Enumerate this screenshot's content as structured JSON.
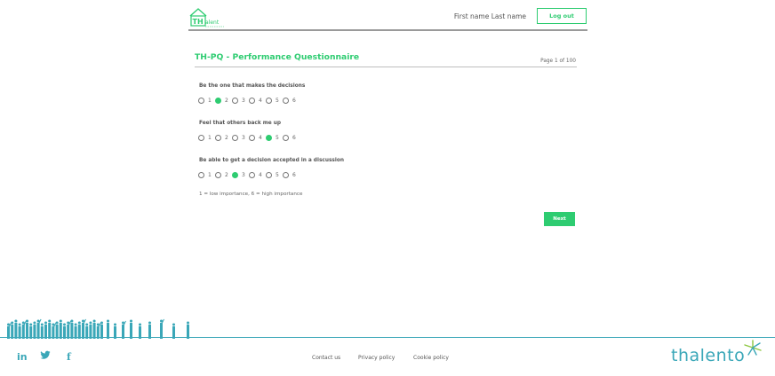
{
  "header": {
    "logo_text": "TH alent",
    "user_name": "First name Last name",
    "logout_label": "Log out"
  },
  "questionnaire": {
    "title": "TH-PQ - Performance Questionnaire",
    "page_indicator": "Page 1 of 100",
    "options": [
      "1",
      "2",
      "3",
      "4",
      "5",
      "6"
    ],
    "questions": [
      {
        "label": "Be the one that makes the decisions",
        "selected": "2"
      },
      {
        "label": "Feel that others back me up",
        "selected": "5"
      },
      {
        "label": "Be able to get a decision accepted in a discussion",
        "selected": "3"
      }
    ],
    "scale_note": "1 = low importance, 6 = high importance",
    "next_label": "Next"
  },
  "footer": {
    "social": [
      "in",
      "twitter-icon",
      "f"
    ],
    "links": [
      "Contact us",
      "Privacy policy",
      "Cookie policy"
    ],
    "brand_logo": "thalento",
    "accent_color": "#3aa7b8"
  },
  "colors": {
    "primary": "#2ecc71",
    "rule": "#9a9a9a"
  }
}
